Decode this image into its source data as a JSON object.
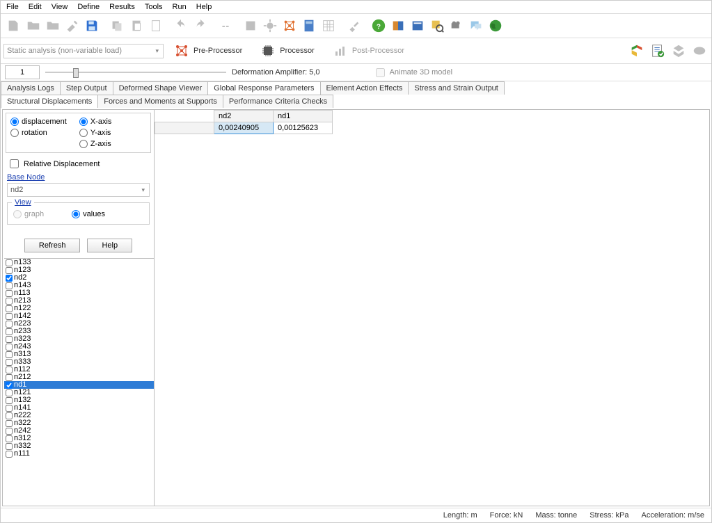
{
  "menu": [
    "File",
    "Edit",
    "View",
    "Define",
    "Results",
    "Tools",
    "Run",
    "Help"
  ],
  "analysisType": "Static analysis (non-variable load)",
  "proc": {
    "pre": "Pre-Processor",
    "proc": "Processor",
    "post": "Post-Processor"
  },
  "spinnerVal": "1",
  "ampLabel": "Deformation Amplifier: 5,0",
  "animateLabel": "Animate 3D model",
  "tabsRow1": [
    "Analysis Logs",
    "Step Output",
    "Deformed Shape Viewer",
    "Global Response Parameters",
    "Element Action Effects",
    "Stress and Strain Output"
  ],
  "tabsRow1Active": 3,
  "tabsRow2": [
    "Structural Displacements",
    "Forces and Moments at Supports",
    "Performance Criteria Checks"
  ],
  "tabsRow2Active": 0,
  "opts": {
    "dispLabel": "displacement",
    "rotLabel": "rotation",
    "xLabel": "X-axis",
    "yLabel": "Y-axis",
    "zLabel": "Z-axis",
    "dispSel": "displacement",
    "axisSel": "X-axis",
    "relLabel": "Relative Displacement",
    "relChecked": false,
    "baseLabel": "Base Node",
    "baseValue": "nd2",
    "viewLegend": "View",
    "graphLabel": "graph",
    "valuesLabel": "values",
    "viewSel": "values",
    "refresh": "Refresh",
    "help": "Help"
  },
  "nodes": [
    {
      "id": "n133",
      "c": false
    },
    {
      "id": "n123",
      "c": false
    },
    {
      "id": "nd2",
      "c": true
    },
    {
      "id": "n143",
      "c": false
    },
    {
      "id": "n113",
      "c": false
    },
    {
      "id": "n213",
      "c": false
    },
    {
      "id": "n122",
      "c": false
    },
    {
      "id": "n142",
      "c": false
    },
    {
      "id": "n223",
      "c": false
    },
    {
      "id": "n233",
      "c": false
    },
    {
      "id": "n323",
      "c": false
    },
    {
      "id": "n243",
      "c": false
    },
    {
      "id": "n313",
      "c": false
    },
    {
      "id": "n333",
      "c": false
    },
    {
      "id": "n112",
      "c": false
    },
    {
      "id": "n212",
      "c": false
    },
    {
      "id": "nd1",
      "c": true,
      "sel": true
    },
    {
      "id": "n121",
      "c": false
    },
    {
      "id": "n132",
      "c": false
    },
    {
      "id": "n141",
      "c": false
    },
    {
      "id": "n222",
      "c": false
    },
    {
      "id": "n322",
      "c": false
    },
    {
      "id": "n242",
      "c": false
    },
    {
      "id": "n312",
      "c": false
    },
    {
      "id": "n332",
      "c": false
    },
    {
      "id": "n111",
      "c": false
    }
  ],
  "table": {
    "headers": [
      "nd2",
      "nd1"
    ],
    "row": [
      "0,00240905",
      "0,00125623"
    ]
  },
  "status": {
    "length": "Length: m",
    "force": "Force: kN",
    "mass": "Mass: tonne",
    "stress": "Stress: kPa",
    "accel": "Acceleration: m/se"
  }
}
